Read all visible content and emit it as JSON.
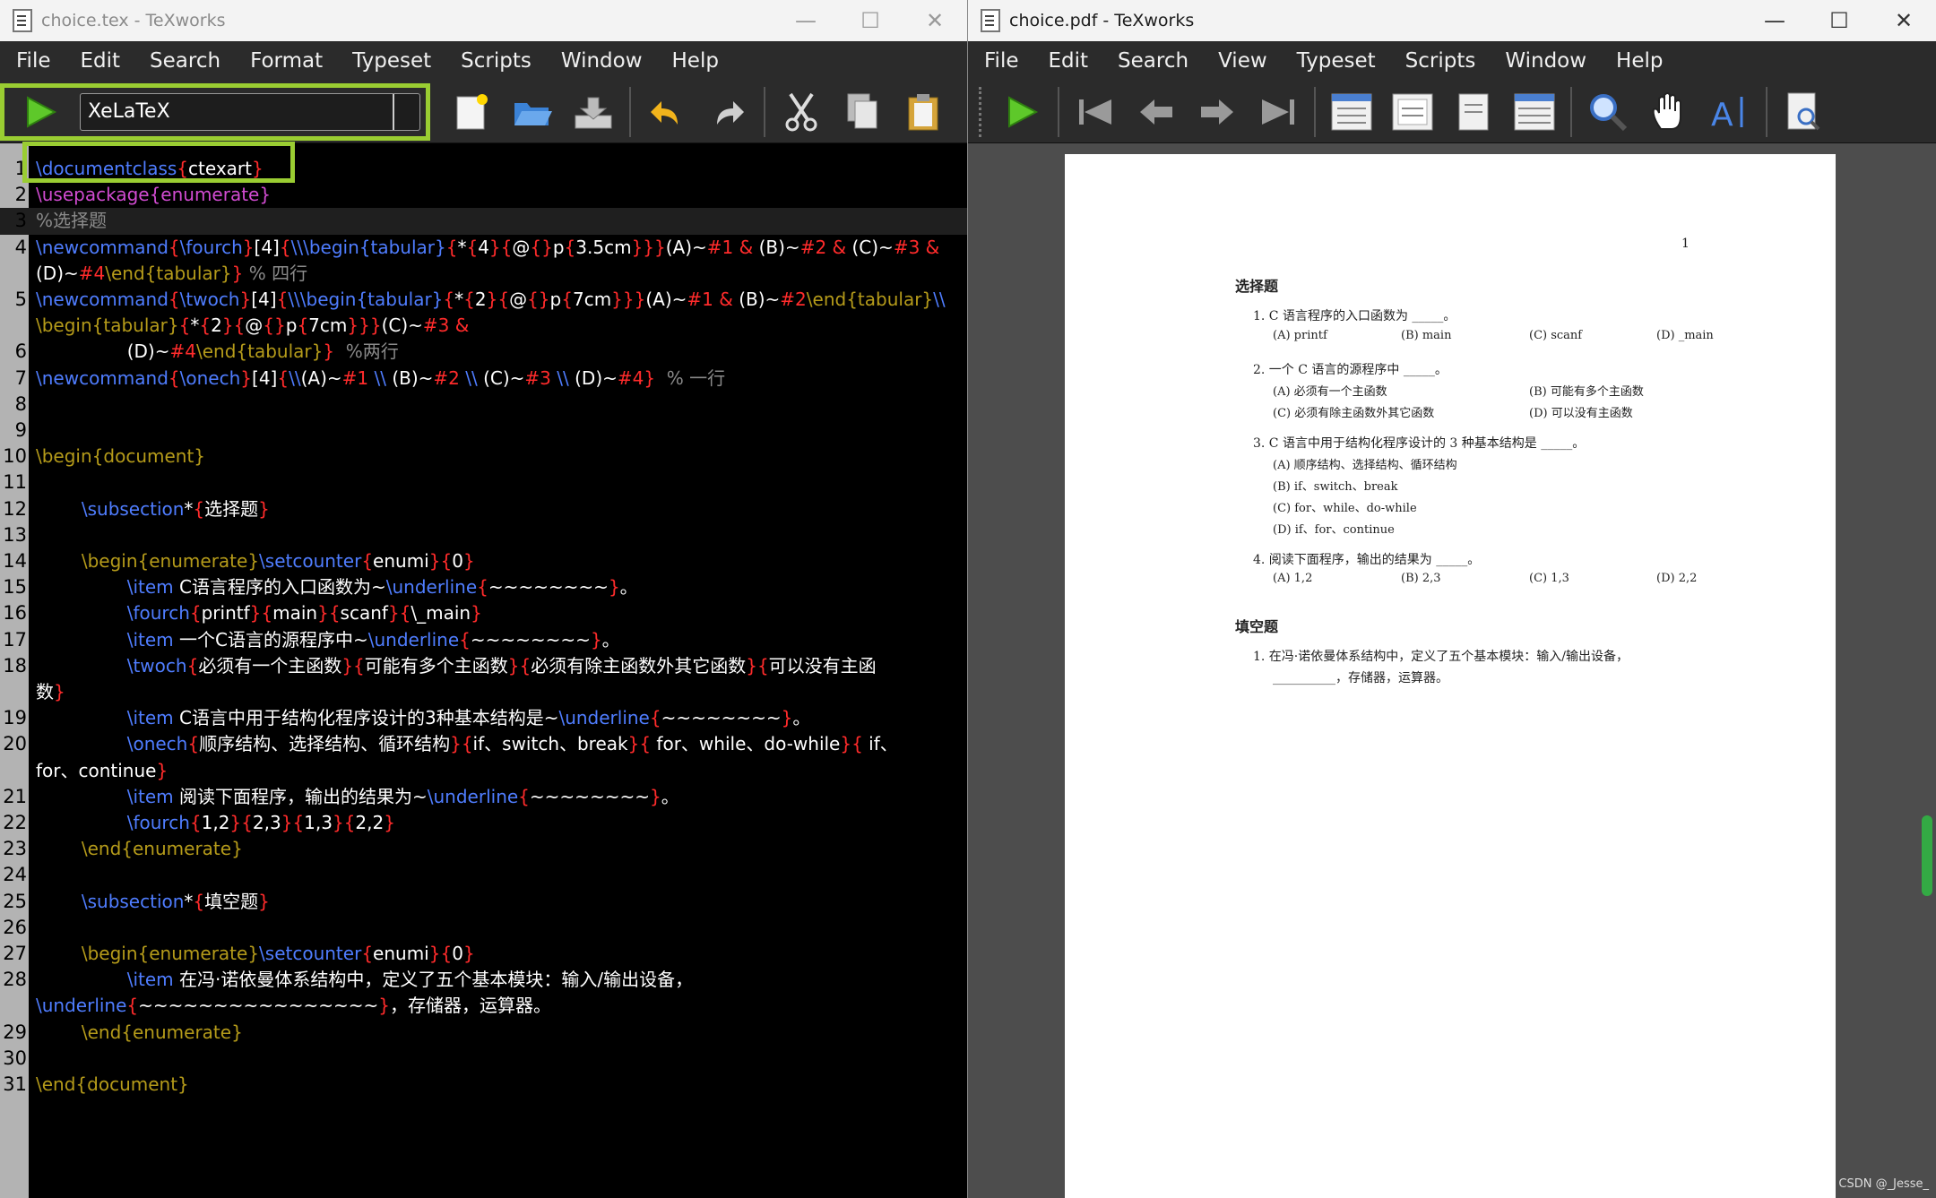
{
  "editor": {
    "title": "choice.tex - TeXworks",
    "menu": [
      "File",
      "Edit",
      "Search",
      "Format",
      "Typeset",
      "Scripts",
      "Window",
      "Help"
    ],
    "typeset_engine": "XeLaTeX",
    "lines": [
      {
        "n": "1",
        "s": [
          [
            "kw",
            "\\documentclass"
          ],
          [
            "br",
            "{"
          ],
          [
            "wt",
            "ctexart"
          ],
          [
            "br",
            "}"
          ]
        ]
      },
      {
        "n": "2",
        "s": [
          [
            "pk",
            "\\usepackage{enumerate}"
          ]
        ]
      },
      {
        "n": "3",
        "s": [
          [
            "cm",
            "%选择题"
          ]
        ],
        "hl": true
      },
      {
        "n": "4",
        "s": [
          [
            "kw",
            "\\newcommand"
          ],
          [
            "br",
            "{"
          ],
          [
            "kw",
            "\\fourch"
          ],
          [
            "br",
            "}"
          ],
          [
            "wt",
            "[4]"
          ],
          [
            "br",
            "{"
          ],
          [
            "kw",
            "\\\\\\begin{tabular}"
          ],
          [
            "br",
            "{"
          ],
          [
            "wt",
            "*"
          ],
          [
            "br",
            "{"
          ],
          [
            "wt",
            "4"
          ],
          [
            "br",
            "}{"
          ],
          [
            "wt",
            "@"
          ],
          [
            "br",
            "{}"
          ],
          [
            "wt",
            "p"
          ],
          [
            "br",
            "{"
          ],
          [
            "wt",
            "3.5cm"
          ],
          [
            "br",
            "}}}"
          ],
          [
            "wt",
            "(A)~"
          ],
          [
            "br",
            "#1 & "
          ],
          [
            "wt",
            "(B)~"
          ],
          [
            "br",
            "#2 & "
          ],
          [
            "wt",
            "(C)~"
          ],
          [
            "br",
            "#3 &"
          ]
        ]
      },
      {
        "n": "",
        "s": [
          [
            "wt",
            "(D)~"
          ],
          [
            "br",
            "#4"
          ],
          [
            "env",
            "\\end{tabular}"
          ],
          [
            "br",
            "}"
          ],
          [
            "cm",
            " % 四行"
          ]
        ]
      },
      {
        "n": "5",
        "s": [
          [
            "kw",
            "\\newcommand"
          ],
          [
            "br",
            "{"
          ],
          [
            "kw",
            "\\twoch"
          ],
          [
            "br",
            "}"
          ],
          [
            "wt",
            "[4]"
          ],
          [
            "br",
            "{"
          ],
          [
            "kw",
            "\\\\\\begin{tabular}"
          ],
          [
            "br",
            "{"
          ],
          [
            "wt",
            "*"
          ],
          [
            "br",
            "{"
          ],
          [
            "wt",
            "2"
          ],
          [
            "br",
            "}{"
          ],
          [
            "wt",
            "@"
          ],
          [
            "br",
            "{}"
          ],
          [
            "wt",
            "p"
          ],
          [
            "br",
            "{"
          ],
          [
            "wt",
            "7cm"
          ],
          [
            "br",
            "}}}"
          ],
          [
            "wt",
            "(A)~"
          ],
          [
            "br",
            "#1 & "
          ],
          [
            "wt",
            "(B)~"
          ],
          [
            "br",
            "#2"
          ],
          [
            "env",
            "\\end{tabular}"
          ],
          [
            "kw",
            "\\\\"
          ]
        ]
      },
      {
        "n": "",
        "s": [
          [
            "env",
            "\\begin{tabular}"
          ],
          [
            "br",
            "{"
          ],
          [
            "wt",
            "*"
          ],
          [
            "br",
            "{"
          ],
          [
            "wt",
            "2"
          ],
          [
            "br",
            "}{"
          ],
          [
            "wt",
            "@"
          ],
          [
            "br",
            "{}"
          ],
          [
            "wt",
            "p"
          ],
          [
            "br",
            "{"
          ],
          [
            "wt",
            "7cm"
          ],
          [
            "br",
            "}}}"
          ],
          [
            "wt",
            "(C)~"
          ],
          [
            "br",
            "#3 &"
          ]
        ]
      },
      {
        "n": "6",
        "s": [
          [
            "wt",
            "\t\t(D)~"
          ],
          [
            "br",
            "#4"
          ],
          [
            "env",
            "\\end{tabular}"
          ],
          [
            "br",
            "}"
          ],
          [
            "cm",
            "  %两行"
          ]
        ]
      },
      {
        "n": "7",
        "s": [
          [
            "kw",
            "\\newcommand"
          ],
          [
            "br",
            "{"
          ],
          [
            "kw",
            "\\onech"
          ],
          [
            "br",
            "}"
          ],
          [
            "wt",
            "[4]"
          ],
          [
            "br",
            "{"
          ],
          [
            "kw",
            "\\\\"
          ],
          [
            "wt",
            "(A)~"
          ],
          [
            "br",
            "#1 "
          ],
          [
            "kw",
            "\\\\ "
          ],
          [
            "wt",
            "(B)~"
          ],
          [
            "br",
            "#2 "
          ],
          [
            "kw",
            "\\\\ "
          ],
          [
            "wt",
            "(C)~"
          ],
          [
            "br",
            "#3 "
          ],
          [
            "kw",
            "\\\\ "
          ],
          [
            "wt",
            "(D)~"
          ],
          [
            "br",
            "#4}"
          ],
          [
            "cm",
            "  % 一行"
          ]
        ]
      },
      {
        "n": "8",
        "s": []
      },
      {
        "n": "9",
        "s": []
      },
      {
        "n": "10",
        "s": [
          [
            "env",
            "\\begin{document}"
          ]
        ]
      },
      {
        "n": "11",
        "s": []
      },
      {
        "n": "12",
        "s": [
          [
            "wt",
            "\t"
          ],
          [
            "kw",
            "\\subsection"
          ],
          [
            "wt",
            "*"
          ],
          [
            "br",
            "{"
          ],
          [
            "wt",
            "选择题"
          ],
          [
            "br",
            "}"
          ]
        ]
      },
      {
        "n": "13",
        "s": []
      },
      {
        "n": "14",
        "s": [
          [
            "wt",
            "\t"
          ],
          [
            "env",
            "\\begin{enumerate}"
          ],
          [
            "kw",
            "\\setcounter"
          ],
          [
            "br",
            "{"
          ],
          [
            "wt",
            "enumi"
          ],
          [
            "br",
            "}{"
          ],
          [
            "wt",
            "0"
          ],
          [
            "br",
            "}"
          ]
        ]
      },
      {
        "n": "15",
        "s": [
          [
            "wt",
            "\t\t"
          ],
          [
            "kw",
            "\\item "
          ],
          [
            "wt",
            "C语言程序的入口函数为~"
          ],
          [
            "kw",
            "\\underline"
          ],
          [
            "br",
            "{"
          ],
          [
            "wt",
            "~~~~~~~~"
          ],
          [
            "br",
            "}"
          ],
          [
            "wt",
            "。"
          ]
        ]
      },
      {
        "n": "16",
        "s": [
          [
            "wt",
            "\t\t"
          ],
          [
            "kw",
            "\\fourch"
          ],
          [
            "br",
            "{"
          ],
          [
            "wt",
            "printf"
          ],
          [
            "br",
            "}{"
          ],
          [
            "wt",
            "main"
          ],
          [
            "br",
            "}{"
          ],
          [
            "wt",
            "scanf"
          ],
          [
            "br",
            "}{"
          ],
          [
            "wt",
            "\\_main"
          ],
          [
            "br",
            "}"
          ]
        ]
      },
      {
        "n": "17",
        "s": [
          [
            "wt",
            "\t\t"
          ],
          [
            "kw",
            "\\item "
          ],
          [
            "wt",
            "一个C语言的源程序中~"
          ],
          [
            "kw",
            "\\underline"
          ],
          [
            "br",
            "{"
          ],
          [
            "wt",
            "~~~~~~~~"
          ],
          [
            "br",
            "}"
          ],
          [
            "wt",
            "。"
          ]
        ]
      },
      {
        "n": "18",
        "s": [
          [
            "wt",
            "\t\t"
          ],
          [
            "kw",
            "\\twoch"
          ],
          [
            "br",
            "{"
          ],
          [
            "wt",
            "必须有一个主函数"
          ],
          [
            "br",
            "}{"
          ],
          [
            "wt",
            "可能有多个主函数"
          ],
          [
            "br",
            "}{"
          ],
          [
            "wt",
            "必须有除主函数外其它函数"
          ],
          [
            "br",
            "}{"
          ],
          [
            "wt",
            "可以没有主函"
          ]
        ]
      },
      {
        "n": "",
        "s": [
          [
            "wt",
            "数"
          ],
          [
            "br",
            "}"
          ]
        ]
      },
      {
        "n": "19",
        "s": [
          [
            "wt",
            "\t\t"
          ],
          [
            "kw",
            "\\item "
          ],
          [
            "wt",
            "C语言中用于结构化程序设计的3种基本结构是~"
          ],
          [
            "kw",
            "\\underline"
          ],
          [
            "br",
            "{"
          ],
          [
            "wt",
            "~~~~~~~~"
          ],
          [
            "br",
            "}"
          ],
          [
            "wt",
            "。"
          ]
        ]
      },
      {
        "n": "20",
        "s": [
          [
            "wt",
            "\t\t"
          ],
          [
            "kw",
            "\\onech"
          ],
          [
            "br",
            "{"
          ],
          [
            "wt",
            "顺序结构、选择结构、循环结构"
          ],
          [
            "br",
            "}{"
          ],
          [
            "wt",
            "if、switch、break"
          ],
          [
            "br",
            "}{"
          ],
          [
            "wt",
            " for、while、do-while"
          ],
          [
            "br",
            "}{"
          ],
          [
            "wt",
            " if、"
          ]
        ]
      },
      {
        "n": "",
        "s": [
          [
            "wt",
            "for、continue"
          ],
          [
            "br",
            "}"
          ]
        ]
      },
      {
        "n": "21",
        "s": [
          [
            "wt",
            "\t\t"
          ],
          [
            "kw",
            "\\item "
          ],
          [
            "wt",
            "阅读下面程序，输出的结果为~"
          ],
          [
            "kw",
            "\\underline"
          ],
          [
            "br",
            "{"
          ],
          [
            "wt",
            "~~~~~~~~"
          ],
          [
            "br",
            "}"
          ],
          [
            "wt",
            "。"
          ]
        ]
      },
      {
        "n": "22",
        "s": [
          [
            "wt",
            "\t\t"
          ],
          [
            "kw",
            "\\fourch"
          ],
          [
            "br",
            "{"
          ],
          [
            "wt",
            "1,2"
          ],
          [
            "br",
            "}{"
          ],
          [
            "wt",
            "2,3"
          ],
          [
            "br",
            "}{"
          ],
          [
            "wt",
            "1,3"
          ],
          [
            "br",
            "}{"
          ],
          [
            "wt",
            "2,2"
          ],
          [
            "br",
            "}"
          ]
        ]
      },
      {
        "n": "23",
        "s": [
          [
            "wt",
            "\t"
          ],
          [
            "env",
            "\\end{enumerate}"
          ]
        ]
      },
      {
        "n": "24",
        "s": []
      },
      {
        "n": "25",
        "s": [
          [
            "wt",
            "\t"
          ],
          [
            "kw",
            "\\subsection"
          ],
          [
            "wt",
            "*"
          ],
          [
            "br",
            "{"
          ],
          [
            "wt",
            "填空题"
          ],
          [
            "br",
            "}"
          ]
        ]
      },
      {
        "n": "26",
        "s": []
      },
      {
        "n": "27",
        "s": [
          [
            "wt",
            "\t"
          ],
          [
            "env",
            "\\begin{enumerate}"
          ],
          [
            "kw",
            "\\setcounter"
          ],
          [
            "br",
            "{"
          ],
          [
            "wt",
            "enumi"
          ],
          [
            "br",
            "}{"
          ],
          [
            "wt",
            "0"
          ],
          [
            "br",
            "}"
          ]
        ]
      },
      {
        "n": "28",
        "s": [
          [
            "wt",
            "\t\t"
          ],
          [
            "kw",
            "\\item "
          ],
          [
            "wt",
            "在冯·诺依曼体系结构中，定义了五个基本模块：输入/输出设备，"
          ]
        ]
      },
      {
        "n": "",
        "s": [
          [
            "kw",
            "\\underline"
          ],
          [
            "br",
            "{"
          ],
          [
            "wt",
            "~~~~~~~~~~~~~~~~"
          ],
          [
            "br",
            "}"
          ],
          [
            "wt",
            "，存储器，运算器。"
          ]
        ]
      },
      {
        "n": "29",
        "s": [
          [
            "wt",
            "\t"
          ],
          [
            "env",
            "\\end{enumerate}"
          ]
        ]
      },
      {
        "n": "30",
        "s": []
      },
      {
        "n": "31",
        "s": [
          [
            "env",
            "\\end{document}"
          ]
        ]
      }
    ]
  },
  "viewer": {
    "title": "choice.pdf - TeXworks",
    "menu": [
      "File",
      "Edit",
      "Search",
      "View",
      "Typeset",
      "Scripts",
      "Window",
      "Help"
    ],
    "page": {
      "page_number": "1",
      "section1": "选择题",
      "q1": "1. C 语言程序的入口函数为 _____。",
      "q1_opts": [
        "(A) printf",
        "(B) main",
        "(C) scanf",
        "(D) _main"
      ],
      "q2": "2. 一个 C 语言的源程序中 _____。",
      "q2_opts": [
        "(A) 必须有一个主函数",
        "(B) 可能有多个主函数",
        "(C) 必须有除主函数外其它函数",
        "(D) 可以没有主函数"
      ],
      "q3": "3. C 语言中用于结构化程序设计的 3 种基本结构是 _____。",
      "q3_opts": [
        "(A) 顺序结构、选择结构、循环结构",
        "(B) if、switch、break",
        "(C) for、while、do-while",
        "(D) if、for、continue"
      ],
      "q4": "4. 阅读下面程序，输出的结果为 _____。",
      "q4_opts": [
        "(A) 1,2",
        "(B) 2,3",
        "(C) 1,3",
        "(D) 2,2"
      ],
      "section2": "填空题",
      "f1_line1": "1. 在冯·诺依曼体系结构中，定义了五个基本模块：输入/输出设备，",
      "f1_line2": "__________，存储器，运算器。"
    },
    "watermark": "CSDN @_Jesse_"
  }
}
